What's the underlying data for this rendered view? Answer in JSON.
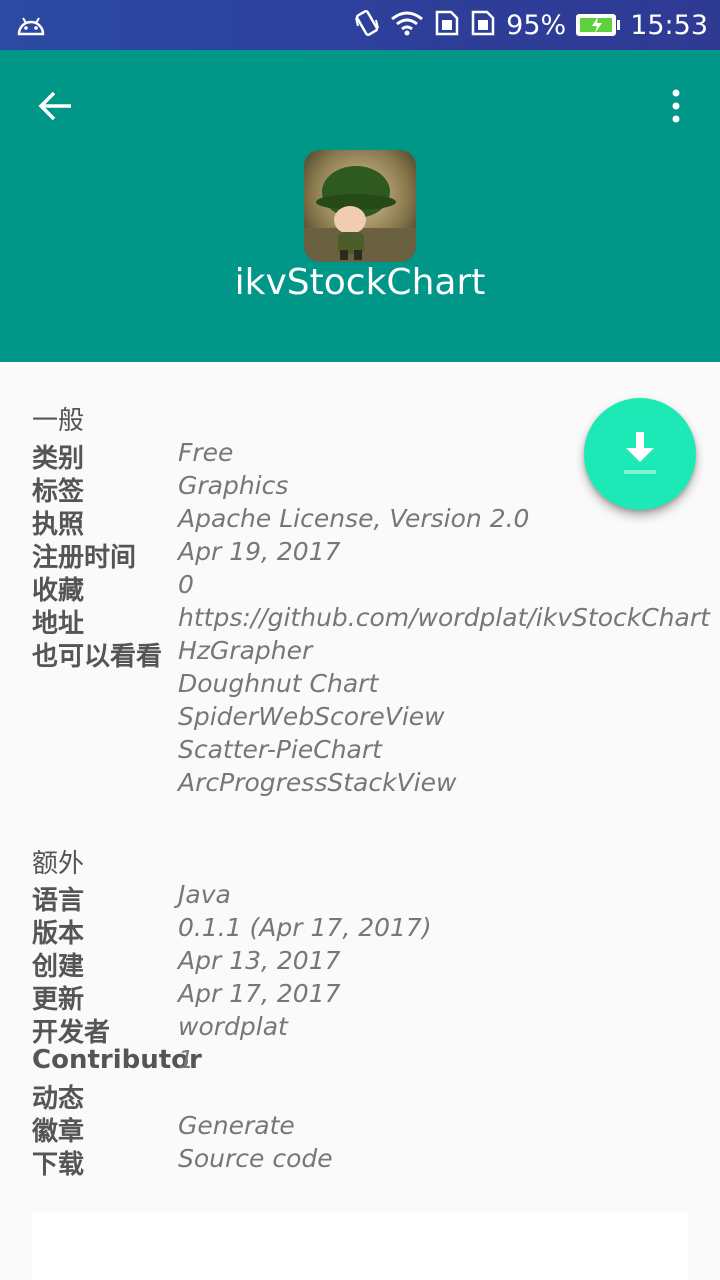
{
  "status_bar": {
    "battery_percent": "95%",
    "time": "15:53",
    "icons": [
      "android-icon",
      "vibrate-icon",
      "wifi-icon",
      "sim1-icon",
      "sim2-icon",
      "battery-charging-icon"
    ]
  },
  "app_bar": {
    "back_icon": "arrow-left-icon",
    "more_icon": "more-vert-icon",
    "app_name": "ikvStockChart",
    "primary_color": "#009688"
  },
  "general": {
    "title": "一般",
    "rows": [
      {
        "label": "类别",
        "value": "Free"
      },
      {
        "label": "标签",
        "value": "Graphics"
      },
      {
        "label": "执照",
        "value": "Apache License, Version 2.0"
      },
      {
        "label": "注册时间",
        "value": "Apr 19, 2017"
      },
      {
        "label": "收藏",
        "value": "0"
      },
      {
        "label": "地址",
        "value": "https://github.com/wordplat/ikvStockChart"
      },
      {
        "label": "也可以看看",
        "value": "HzGrapher"
      }
    ],
    "see_also_more": [
      "Doughnut Chart",
      "SpiderWebScoreView",
      "Scatter-PieChart",
      "ArcProgressStackView"
    ]
  },
  "extra": {
    "title": "额外",
    "rows": [
      {
        "label": "语言",
        "value": "Java"
      },
      {
        "label": "版本",
        "value": "0.1.1 (Apr 17, 2017)"
      },
      {
        "label": "创建",
        "value": "Apr 13, 2017"
      },
      {
        "label": "更新",
        "value": "Apr 17, 2017"
      },
      {
        "label": "开发者",
        "value": "wordplat"
      },
      {
        "label": "Contributor",
        "value": "1"
      },
      {
        "label": "动态",
        "value": ""
      },
      {
        "label": "徽章",
        "value": "Generate"
      },
      {
        "label": "下载",
        "value": "Source code"
      }
    ]
  },
  "fab": {
    "icon": "download-icon",
    "color": "#1de9b6"
  }
}
